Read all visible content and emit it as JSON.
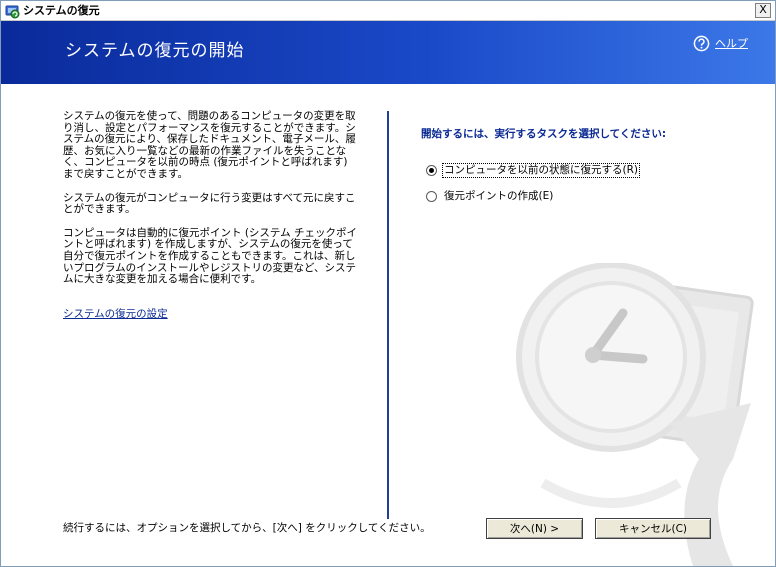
{
  "window": {
    "title": "システムの復元",
    "close_label": "X"
  },
  "header": {
    "page_title": "システムの復元の開始",
    "help_label": "ヘルプ"
  },
  "intro": {
    "paragraph1": "システムの復元を使って、問題のあるコンピュータの変更を取り消し、設定とパフォーマンスを復元することができます。システムの復元により、保存したドキュメント、電子メール、履歴、お気に入り一覧などの最新の作業ファイルを失うことなく、コンピュータを以前の時点 (復元ポイントと呼ばれます) まで戻すことができます。",
    "paragraph2": "システムの復元がコンピュータに行う変更はすべて元に戻すことができます。",
    "paragraph3": "コンピュータは自動的に復元ポイント (システム チェックポイントと呼ばれます) を作成しますが、システムの復元を使って自分で復元ポイントを作成することもできます。これは、新しいプログラムのインストールやレジストリの変更など、システムに大きな変更を加える場合に便利です。",
    "settings_link": "システムの復元の設定"
  },
  "tasks": {
    "prompt": "開始するには、実行するタスクを選択してください:",
    "options": [
      {
        "label": "コンピュータを以前の状態に復元する(R)",
        "selected": true
      },
      {
        "label": "復元ポイントの作成(E)",
        "selected": false
      }
    ]
  },
  "footer": {
    "instruction": "続行するには、オプションを選択してから、[次へ] をクリックしてください。",
    "next_label": "次へ(N) >",
    "cancel_label": "キャンセル(C)"
  },
  "colors": {
    "header_dark": "#0a2a9a",
    "header_light": "#3c78e8",
    "link": "#0b2a94",
    "divider": "#1f3f9a"
  },
  "icons": {
    "app": "system-restore-icon",
    "help": "help-question-icon",
    "watermark": "clock-restore-watermark-icon"
  }
}
